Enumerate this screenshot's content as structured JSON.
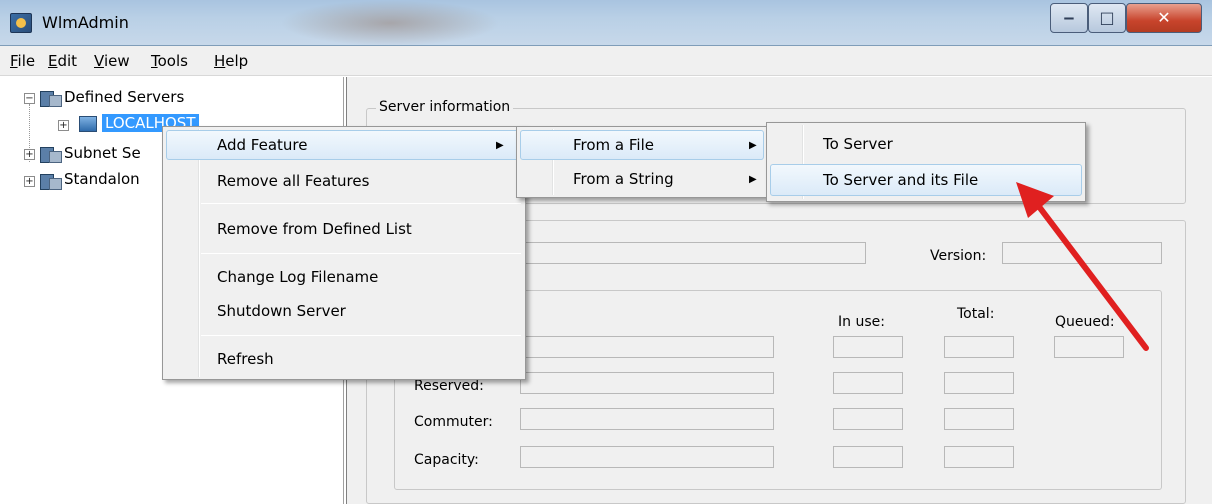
{
  "window": {
    "title": "WlmAdmin",
    "minimize": "‒",
    "maximize": "□",
    "close": "✕"
  },
  "menubar": [
    {
      "label": "File",
      "mnemonic": "F",
      "rest": "ile"
    },
    {
      "label": "Edit",
      "mnemonic": "E",
      "rest": "dit"
    },
    {
      "label": "View",
      "mnemonic": "V",
      "rest": "iew"
    },
    {
      "label": "Tools",
      "mnemonic": "T",
      "rest": "ools"
    },
    {
      "label": "Help",
      "mnemonic": "H",
      "rest": "elp"
    }
  ],
  "tree": {
    "defined_servers": "Defined Servers",
    "localhost": "LOCALHOST",
    "subnet": "Subnet Se",
    "standalone": "Standalon",
    "expand": "+",
    "collapse": "−"
  },
  "context_menu": {
    "add_feature": "Add Feature",
    "remove_all": "Remove all Features",
    "remove_defined": "Remove from Defined List",
    "change_log": "Change Log Filename",
    "shutdown": "Shutdown Server",
    "refresh": "Refresh",
    "arrow": "▶"
  },
  "submenu1": {
    "from_file": "From a File",
    "from_string": "From a String"
  },
  "submenu2": {
    "to_server": "To Server",
    "to_server_file": "To Server and its File"
  },
  "panel": {
    "server_info": "Server information",
    "version": "Version:",
    "in_use": "In use:",
    "total": "Total:",
    "queued": "Queued:",
    "reserved": "Reserved:",
    "commuter": "Commuter:",
    "capacity": "Capacity:"
  },
  "annotation": {
    "color": "#e02020"
  }
}
